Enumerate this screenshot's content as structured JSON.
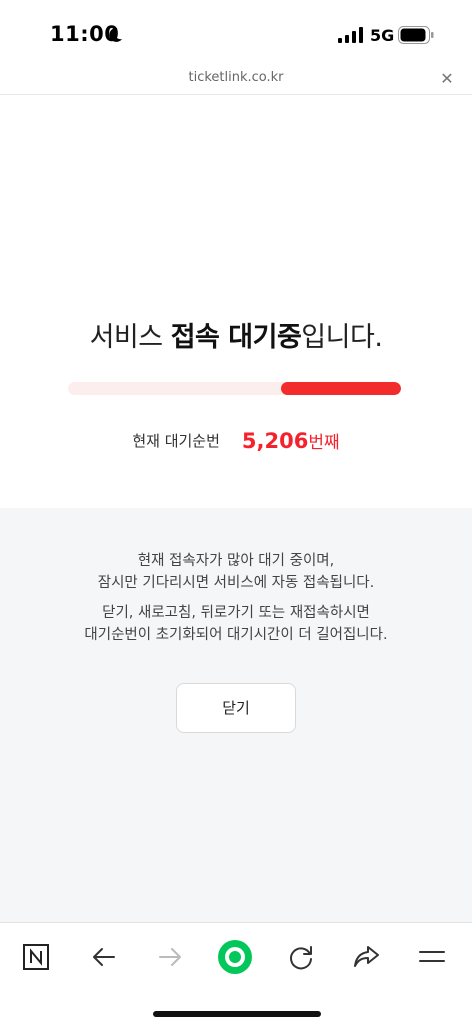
{
  "status_bar": {
    "time": "11:00",
    "network": "5G"
  },
  "url_bar": {
    "domain": "ticketlink.co.kr",
    "close_icon": "close-icon"
  },
  "queue": {
    "headline_pre": "서비스 ",
    "headline_bold": "접속 대기중",
    "headline_post": "입니다.",
    "progress": 0.36,
    "label": "현재 대기순번",
    "number": "5,206",
    "suffix": "번째"
  },
  "notice": {
    "line1": "현재 접속자가 많아 대기 중이며,",
    "line2": "잠시만 기다리시면 서비스에 자동 접속됩니다.",
    "line3": "닫기, 새로고침, 뒤로가기 또는 재접속하시면",
    "line4": "대기순번이 초기화되어 대기시간이 더 길어집니다.",
    "close_label": "닫기"
  },
  "toolbar": {
    "icons": [
      "naver-icon",
      "back-arrow-icon",
      "forward-arrow-icon",
      "green-dot-icon",
      "refresh-icon",
      "share-icon",
      "menu-icon"
    ]
  },
  "colors": {
    "accent_red": "#f22c2c",
    "track": "#fdeeee",
    "gray_bg": "#f5f6f8",
    "green": "#03c75a"
  }
}
